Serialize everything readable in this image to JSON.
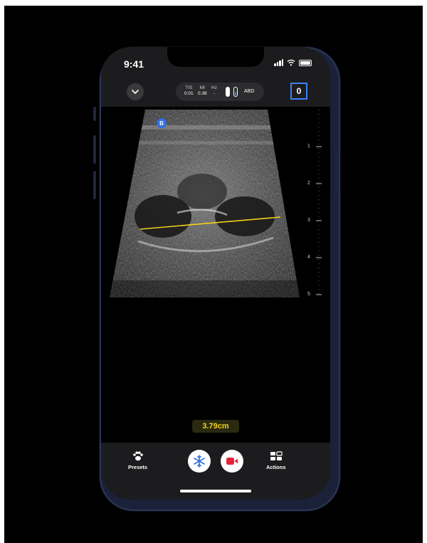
{
  "status_bar": {
    "time": "9:41"
  },
  "params": {
    "tis_label": "TIS",
    "tis_value": "0.01",
    "mi_label": "MI",
    "mi_value": "0.38",
    "hz_label": "Hz",
    "hz_value": "-",
    "preset": "ABD"
  },
  "counter": "0",
  "image_badge": "B",
  "depth_scale": [
    "1",
    "2",
    "3",
    "4",
    "5"
  ],
  "measurement": {
    "value": "3.79cm",
    "color": "#f2d21b"
  },
  "toolbar": {
    "presets_label": "Presets",
    "actions_label": "Actions"
  },
  "colors": {
    "accent_blue": "#3b82f6",
    "record_red": "#e5243b"
  },
  "icons": {
    "collapse": "chevron-down-icon",
    "presets": "paw-icon",
    "freeze": "snowflake-icon",
    "record": "video-camera-icon",
    "actions": "grid-menu-icon"
  }
}
